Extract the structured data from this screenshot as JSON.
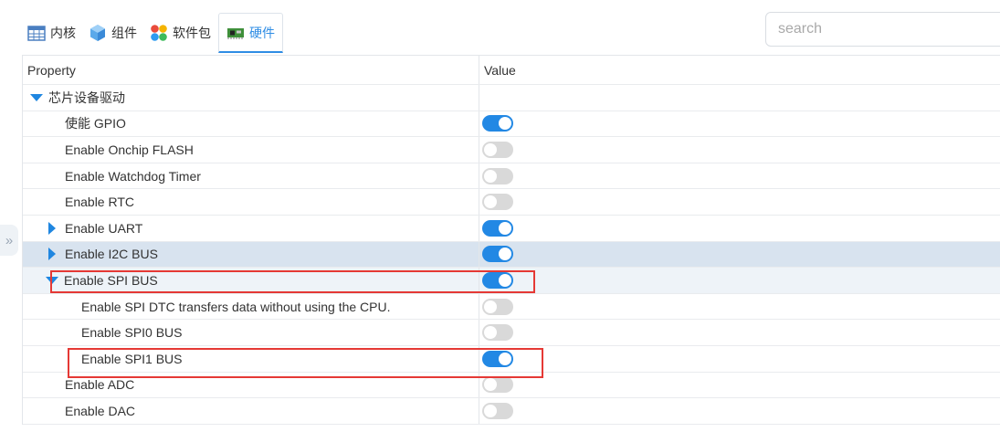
{
  "tabs": [
    {
      "label": "内核",
      "icon": "kernel-table-icon"
    },
    {
      "label": "组件",
      "icon": "component-cube-icon"
    },
    {
      "label": "软件包",
      "icon": "package-dots-icon"
    },
    {
      "label": "硬件",
      "icon": "hardware-board-icon"
    }
  ],
  "search": {
    "placeholder": "search"
  },
  "columns": {
    "property": "Property",
    "value": "Value"
  },
  "section": {
    "label": "芯片设备驱动"
  },
  "rows": [
    {
      "label": "使能 GPIO",
      "on": true
    },
    {
      "label": "Enable Onchip FLASH",
      "on": false
    },
    {
      "label": "Enable Watchdog Timer",
      "on": false
    },
    {
      "label": "Enable RTC",
      "on": false
    },
    {
      "label": "Enable UART",
      "on": true
    },
    {
      "label": "Enable I2C BUS",
      "on": true
    },
    {
      "label": "Enable SPI BUS",
      "on": true
    },
    {
      "label": "Enable SPI DTC transfers data without using the CPU.",
      "on": false
    },
    {
      "label": "Enable SPI0 BUS",
      "on": false
    },
    {
      "label": "Enable SPI1 BUS",
      "on": true
    },
    {
      "label": "Enable ADC",
      "on": false
    },
    {
      "label": "Enable DAC",
      "on": false
    }
  ],
  "colors": {
    "accent": "#2288e4",
    "highlight": "#e53935",
    "selected_row": "#d8e3ef"
  }
}
